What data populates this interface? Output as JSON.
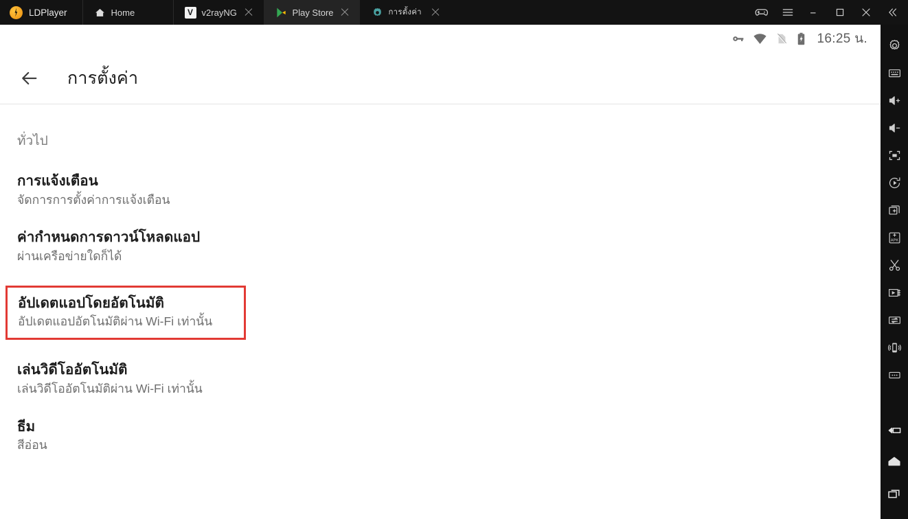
{
  "window": {
    "brand": "LDPlayer",
    "brand_logo_icon": "ldplayer-logo-icon",
    "tabs": [
      {
        "label": "Home",
        "icon": "home-icon",
        "active": false,
        "closable": false
      },
      {
        "label": "v2rayNG",
        "icon": "v2rayng-icon",
        "active": false,
        "closable": true
      },
      {
        "label": "Play Store",
        "icon": "play-store-icon",
        "active": true,
        "closable": true
      },
      {
        "label": "การตั้งค่า",
        "icon": "settings-gear-icon",
        "active": false,
        "closable": true
      }
    ],
    "controls": [
      {
        "name": "gamepad-icon",
        "label": "Gamepad"
      },
      {
        "name": "hamburger-menu-icon",
        "label": "Menu"
      },
      {
        "name": "minimize-icon",
        "label": "Minimize"
      },
      {
        "name": "maximize-icon",
        "label": "Maximize"
      },
      {
        "name": "close-icon",
        "label": "Close"
      },
      {
        "name": "collapse-chevron-icon",
        "label": "Collapse"
      }
    ]
  },
  "statusbar": {
    "time": "16:25 น.",
    "icons": [
      "vpn-key-icon",
      "wifi-icon",
      "no-sim-icon",
      "battery-charging-icon"
    ]
  },
  "toolbar": {
    "back_icon": "back-arrow-icon",
    "title": "การตั้งค่า"
  },
  "settings": {
    "section_header": "ทั่วไป",
    "items": [
      {
        "title": "การแจ้งเตือน",
        "subtitle": "จัดการการตั้งค่าการแจ้งเตือน",
        "highlighted": false
      },
      {
        "title": "ค่ากำหนดการดาวน์โหลดแอป",
        "subtitle": "ผ่านเครือข่ายใดก็ได้",
        "highlighted": false
      },
      {
        "title": "อัปเดตแอปโดยอัตโนมัติ",
        "subtitle": "อัปเดตแอปอัตโนมัติผ่าน Wi-Fi เท่านั้น",
        "highlighted": true
      },
      {
        "title": "เล่นวิดีโออัตโนมัติ",
        "subtitle": "เล่นวิดีโออัตโนมัติผ่าน Wi-Fi เท่านั้น",
        "highlighted": false
      },
      {
        "title": "ธีม",
        "subtitle": "สีอ่อน",
        "highlighted": false
      }
    ]
  },
  "sidebar": {
    "tools": [
      {
        "name": "emulator-settings-icon",
        "label": "Settings"
      },
      {
        "name": "keyboard-icon",
        "label": "Keyboard mapping"
      },
      {
        "name": "volume-up-icon",
        "label": "Volume up"
      },
      {
        "name": "volume-down-icon",
        "label": "Volume down"
      },
      {
        "name": "fullscreen-icon",
        "label": "Full screen"
      },
      {
        "name": "rotate-screen-icon",
        "label": "Rotate"
      },
      {
        "name": "new-window-icon",
        "label": "Multi instance"
      },
      {
        "name": "install-apk-icon",
        "label": "Install APK"
      },
      {
        "name": "screenshot-scissors-icon",
        "label": "Screenshot"
      },
      {
        "name": "record-video-icon",
        "label": "Record"
      },
      {
        "name": "file-transfer-icon",
        "label": "File transfer"
      },
      {
        "name": "shake-device-icon",
        "label": "Shake"
      },
      {
        "name": "more-options-icon",
        "label": "More"
      }
    ],
    "navigation": [
      {
        "name": "android-back-icon",
        "label": "Back"
      },
      {
        "name": "android-home-icon",
        "label": "Home"
      },
      {
        "name": "android-recents-icon",
        "label": "Recent apps"
      }
    ]
  },
  "colors": {
    "highlight_border": "#e23a34",
    "titlebar_bg": "#131313",
    "active_tab_bg": "#242424",
    "sidebar_bg": "#111111",
    "screen_bg": "#ffffff"
  }
}
